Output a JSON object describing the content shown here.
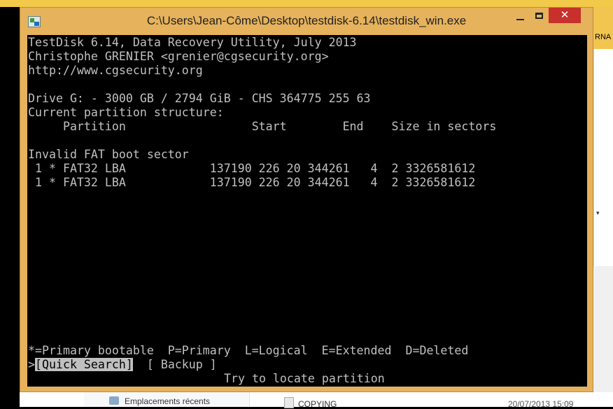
{
  "window": {
    "title": "C:\\Users\\Jean-Côme\\Desktop\\testdisk-6.14\\testdisk_win.exe",
    "close_glyph": "✕"
  },
  "console": {
    "header_line1": "TestDisk 6.14, Data Recovery Utility, July 2013",
    "header_line2": "Christophe GRENIER <grenier@cgsecurity.org>",
    "header_line3": "http://www.cgsecurity.org",
    "drive_info": "Drive G: - 3000 GB / 2794 GiB - CHS 364775 255 63",
    "structure_label": "Current partition structure:",
    "columns_line": "     Partition                  Start        End    Size in sectors",
    "warning": "Invalid FAT boot sector",
    "partitions": [
      " 1 * FAT32 LBA            137190 226 20 344261   4  2 3326581612",
      " 1 * FAT32 LBA            137190 226 20 344261   4  2 3326581612"
    ],
    "legend": "*=Primary bootable  P=Primary  L=Logical  E=Extended  D=Deleted",
    "menu": {
      "cursor": ">",
      "quick_search": "[Quick Search]",
      "backup": "[ Backup ]"
    },
    "hint": "Try to locate partition"
  },
  "background": {
    "right_text": "RNA",
    "nav_item": "Emplacements récents",
    "file_name": "COPYING",
    "file_date": "20/07/2013 15:09"
  }
}
